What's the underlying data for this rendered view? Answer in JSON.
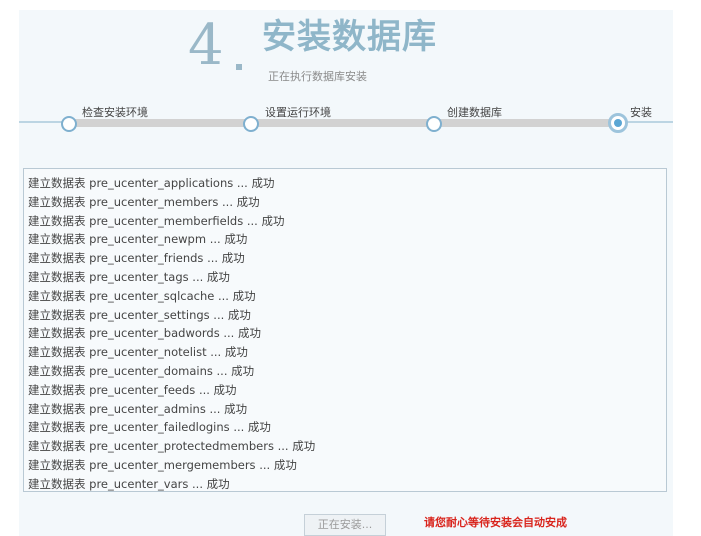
{
  "header": {
    "step_number": "4",
    "title": "安装数据库",
    "subtitle": "正在执行数据库安装"
  },
  "steps": [
    {
      "label": "检查安装环境"
    },
    {
      "label": "设置运行环境"
    },
    {
      "label": "创建数据库"
    },
    {
      "label": "安装"
    }
  ],
  "log": {
    "lines": [
      "建立数据表 pre_ucenter_applications ... 成功",
      "建立数据表 pre_ucenter_members ... 成功",
      "建立数据表 pre_ucenter_memberfields ... 成功",
      "建立数据表 pre_ucenter_newpm ... 成功",
      "建立数据表 pre_ucenter_friends ... 成功",
      "建立数据表 pre_ucenter_tags ... 成功",
      "建立数据表 pre_ucenter_sqlcache ... 成功",
      "建立数据表 pre_ucenter_settings ... 成功",
      "建立数据表 pre_ucenter_badwords ... 成功",
      "建立数据表 pre_ucenter_notelist ... 成功",
      "建立数据表 pre_ucenter_domains ... 成功",
      "建立数据表 pre_ucenter_feeds ... 成功",
      "建立数据表 pre_ucenter_admins ... 成功",
      "建立数据表 pre_ucenter_failedlogins ... 成功",
      "建立数据表 pre_ucenter_protectedmembers ... 成功",
      "建立数据表 pre_ucenter_mergemembers ... 成功",
      "建立数据表 pre_ucenter_vars ... 成功"
    ]
  },
  "footer": {
    "button_label": "正在安装...",
    "notice": "请您耐心等待安装会自动安成"
  },
  "colors": {
    "accent": "#8fb6c9",
    "notice": "#d9251d",
    "active_step": "#5aa6d4"
  }
}
